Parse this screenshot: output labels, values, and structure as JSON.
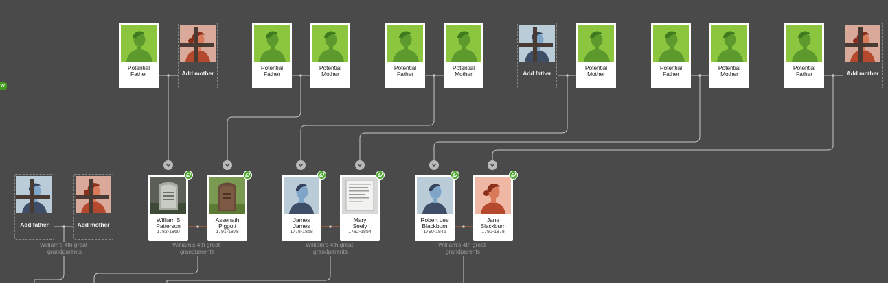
{
  "edge_tag": "W",
  "top_row": [
    {
      "id": "c1",
      "type": "potential",
      "label": "Potential\nFather",
      "avatar": "green-silhouette"
    },
    {
      "id": "c2",
      "type": "add",
      "label": "Add mother",
      "avatar": "female-silhouette"
    },
    {
      "id": "c3",
      "type": "potential",
      "label": "Potential\nFather",
      "avatar": "green-silhouette"
    },
    {
      "id": "c4",
      "type": "potential",
      "label": "Potential\nMother",
      "avatar": "green-silhouette"
    },
    {
      "id": "c5",
      "type": "potential",
      "label": "Potential\nFather",
      "avatar": "green-silhouette"
    },
    {
      "id": "c6",
      "type": "potential",
      "label": "Potential\nMother",
      "avatar": "green-silhouette"
    },
    {
      "id": "c7",
      "type": "add",
      "label": "Add father",
      "avatar": "male-silhouette"
    },
    {
      "id": "c8",
      "type": "potential",
      "label": "Potential\nMother",
      "avatar": "green-silhouette"
    },
    {
      "id": "c9",
      "type": "potential",
      "label": "Potential\nFather",
      "avatar": "green-silhouette"
    },
    {
      "id": "c10",
      "type": "potential",
      "label": "Potential\nMother",
      "avatar": "green-silhouette"
    },
    {
      "id": "c11",
      "type": "potential",
      "label": "Potential\nFather",
      "avatar": "green-silhouette"
    },
    {
      "id": "c12",
      "type": "add",
      "label": "Add mother",
      "avatar": "female-silhouette"
    }
  ],
  "bottom_row": [
    {
      "id": "b1",
      "type": "add",
      "label": "Add father",
      "avatar": "male-silhouette"
    },
    {
      "id": "b2",
      "type": "add",
      "label": "Add mother",
      "avatar": "female-silhouette"
    },
    {
      "id": "b3",
      "type": "person",
      "name": "William B\nPatterson",
      "dates": "1782-1860",
      "avatar": "headstone-photo",
      "hint": true
    },
    {
      "id": "b4",
      "type": "person",
      "name": "Assenath\nPiggott",
      "dates": "1791-1878",
      "avatar": "headstone-photo-green",
      "hint": true
    },
    {
      "id": "b5",
      "type": "person",
      "name": "James\nJames",
      "dates": "1778-1858",
      "avatar": "male-silhouette",
      "hint": true
    },
    {
      "id": "b6",
      "type": "person",
      "name": "Mary\nSeely",
      "dates": "1782-1854",
      "avatar": "document-photo",
      "hint": true
    },
    {
      "id": "b7",
      "type": "person",
      "name": "Robert Lee\nBlackburn",
      "dates": "1790-1845",
      "avatar": "male-silhouette",
      "hint": true
    },
    {
      "id": "b8",
      "type": "person",
      "name": "Jane\nBlackburn",
      "dates": "1790-1878",
      "avatar": "female-silhouette-warm",
      "hint": true
    }
  ],
  "generation_labels": [
    "William's 4th great-\ngrandparents",
    "William's 4th great-\ngrandparents",
    "William's 4th great-\ngrandparents",
    "William's 4th great-\ngrandparents"
  ],
  "colors": {
    "background": "#4a4a4a",
    "potential_green": "#8cc63f",
    "male_blue": "#b9ccd8",
    "female_rose": "#d9a99a",
    "female_warm": "#f0b8a4",
    "hint_green": "#4aa82a",
    "connector": "#c8c8c8",
    "spouse_link": "#d8663a"
  }
}
